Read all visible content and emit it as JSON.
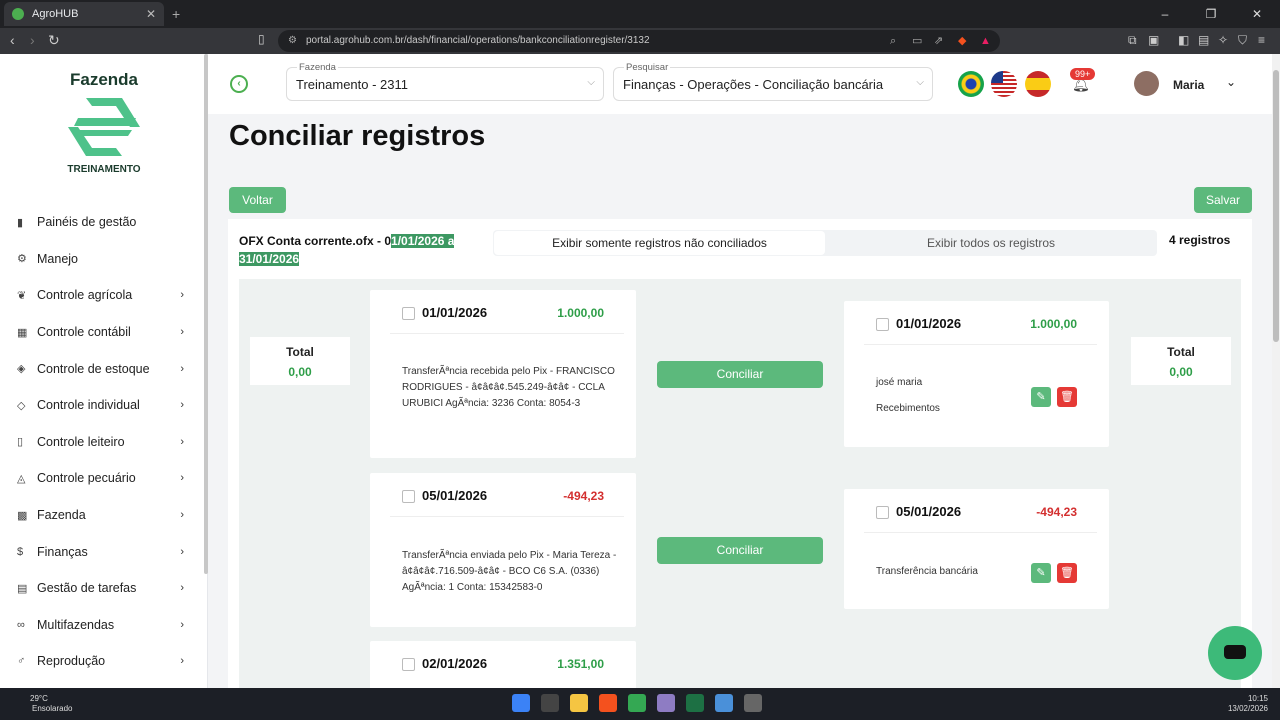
{
  "browser": {
    "tab_title": "AgroHUB",
    "url": "portal.agrohub.com.br/dash/financial/operations/bankconciliationregister/3132"
  },
  "sidebar": {
    "logo_top": "Fazenda",
    "logo_bottom": "TREINAMENTO",
    "items": [
      {
        "label": "Painéis de gestão",
        "icon": "chart-icon"
      },
      {
        "label": "Manejo",
        "icon": "tractor-icon"
      },
      {
        "label": "Controle agrícola",
        "icon": "plant-icon"
      },
      {
        "label": "Controle contábil",
        "icon": "calculator-icon"
      },
      {
        "label": "Controle de estoque",
        "icon": "box-icon"
      },
      {
        "label": "Controle individual",
        "icon": "tag-icon"
      },
      {
        "label": "Controle leiteiro",
        "icon": "milk-icon"
      },
      {
        "label": "Controle pecuário",
        "icon": "cow-icon"
      },
      {
        "label": "Fazenda",
        "icon": "farm-icon"
      },
      {
        "label": "Finanças",
        "icon": "money-icon"
      },
      {
        "label": "Gestão de tarefas",
        "icon": "calendar-icon"
      },
      {
        "label": "Multifazendas",
        "icon": "link-icon"
      },
      {
        "label": "Reprodução",
        "icon": "gender-icon"
      }
    ]
  },
  "header": {
    "farm_label": "Fazenda",
    "farm_value": "Treinamento - 2311",
    "search_label": "Pesquisar",
    "search_value": "Finanças - Operações - Conciliação bancária",
    "notifications": "99+",
    "user": "Maria"
  },
  "page": {
    "title": "Conciliar registros",
    "back_label": "Voltar",
    "save_label": "Salvar",
    "file_prefix": "OFX Conta corrente.ofx - 0",
    "file_period_a": "1/01/2026 a",
    "file_period_b": "31/01/2026",
    "seg_unreconciled": "Exibir somente registros não conciliados",
    "seg_all": "Exibir todos os registros",
    "record_count": "4 registros",
    "total_label": "Total",
    "total_left": "0,00",
    "total_right": "0,00",
    "reconcile_label": "Conciliar"
  },
  "bank_records": [
    {
      "date": "01/01/2026",
      "amount": "1.000,00",
      "desc": "TransferÃªncia recebida pelo Pix - FRANCISCO RODRIGUES - â¢â¢â¢.545.249-â¢â¢ - CCLA URUBICI AgÃªncia: 3236 Conta: 8054-3"
    },
    {
      "date": "05/01/2026",
      "amount": "-494,23",
      "desc": "TransferÃªncia enviada pelo Pix - Maria Tereza - â¢â¢â¢.716.509-â¢â¢ - BCO C6 S.A. (0336) AgÃªncia: 1 Conta: 15342583-0"
    },
    {
      "date": "02/01/2026",
      "amount": "1.351,00",
      "desc": ""
    }
  ],
  "system_records": [
    {
      "date": "01/01/2026",
      "amount": "1.000,00",
      "line1": "josé maria",
      "line2": "Recebimentos"
    },
    {
      "date": "05/01/2026",
      "amount": "-494,23",
      "line1": "Transferência bancária",
      "line2": ""
    }
  ],
  "taskbar": {
    "temp": "29°C",
    "weather": "Ensolarado",
    "time": "10:15",
    "date": "13/02/2026"
  },
  "colors": {
    "accent": "#5cb97c",
    "positive": "#2e9e48",
    "negative": "#d32f2f",
    "delete": "#e53935"
  }
}
